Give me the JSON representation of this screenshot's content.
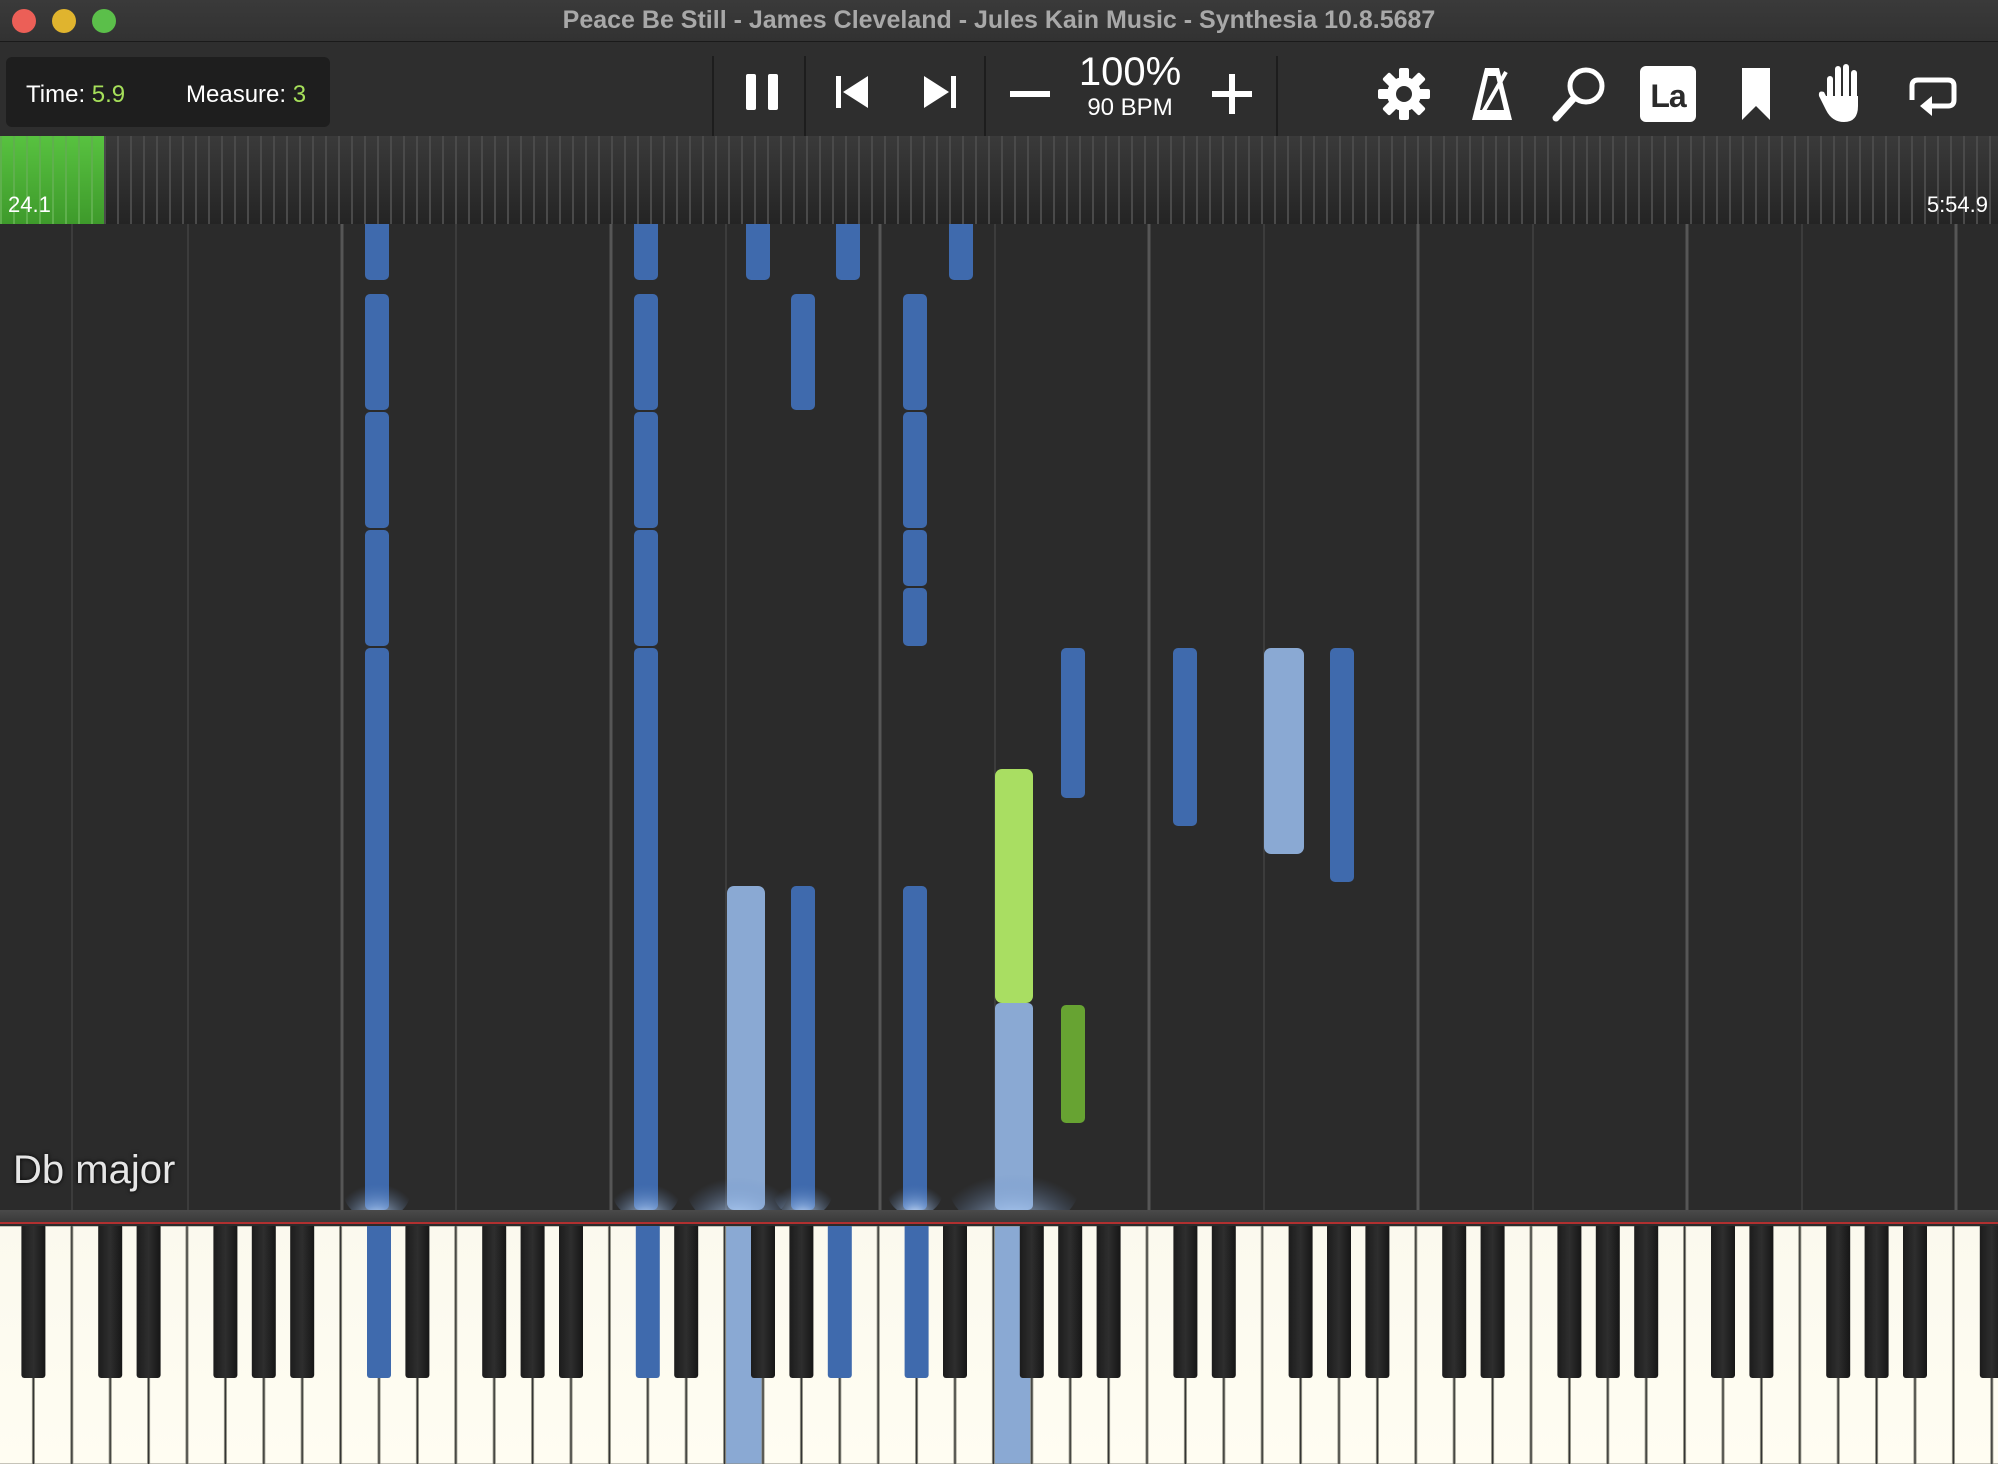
{
  "window": {
    "title": "Peace Be Still - James Cleveland - Jules Kain Music - Synthesia 10.8.5687",
    "traffic_lights": [
      {
        "name": "close",
        "color": "#ec5f57"
      },
      {
        "name": "minimize",
        "color": "#e0b42e"
      },
      {
        "name": "zoom",
        "color": "#5bbf4a"
      }
    ]
  },
  "toolbar": {
    "time_label": "Time:",
    "time_value": "5.9",
    "measure_label": "Measure:",
    "measure_value": "3",
    "speed": "100%",
    "bpm": "90 BPM",
    "buttons": [
      "pause-icon",
      "previous-icon",
      "next-icon",
      "minus-icon",
      "plus-icon",
      "gear-icon",
      "metronome-icon",
      "magnifier-icon",
      "note-label-icon",
      "bookmark-icon",
      "hand-icon",
      "loop-icon"
    ],
    "note_label_text": "La"
  },
  "progress": {
    "start_label": "24.1",
    "end_label": "5:54.9",
    "fraction": 0.052
  },
  "note_field": {
    "key_signature": "Db major"
  },
  "colors": {
    "note_blue": "#3f6aad",
    "note_blue_light": "#8aa9d3",
    "note_green_light": "#a9de62",
    "note_green": "#67a332",
    "accent_green": "#a6e05a",
    "background": "#2b2b2b"
  }
}
